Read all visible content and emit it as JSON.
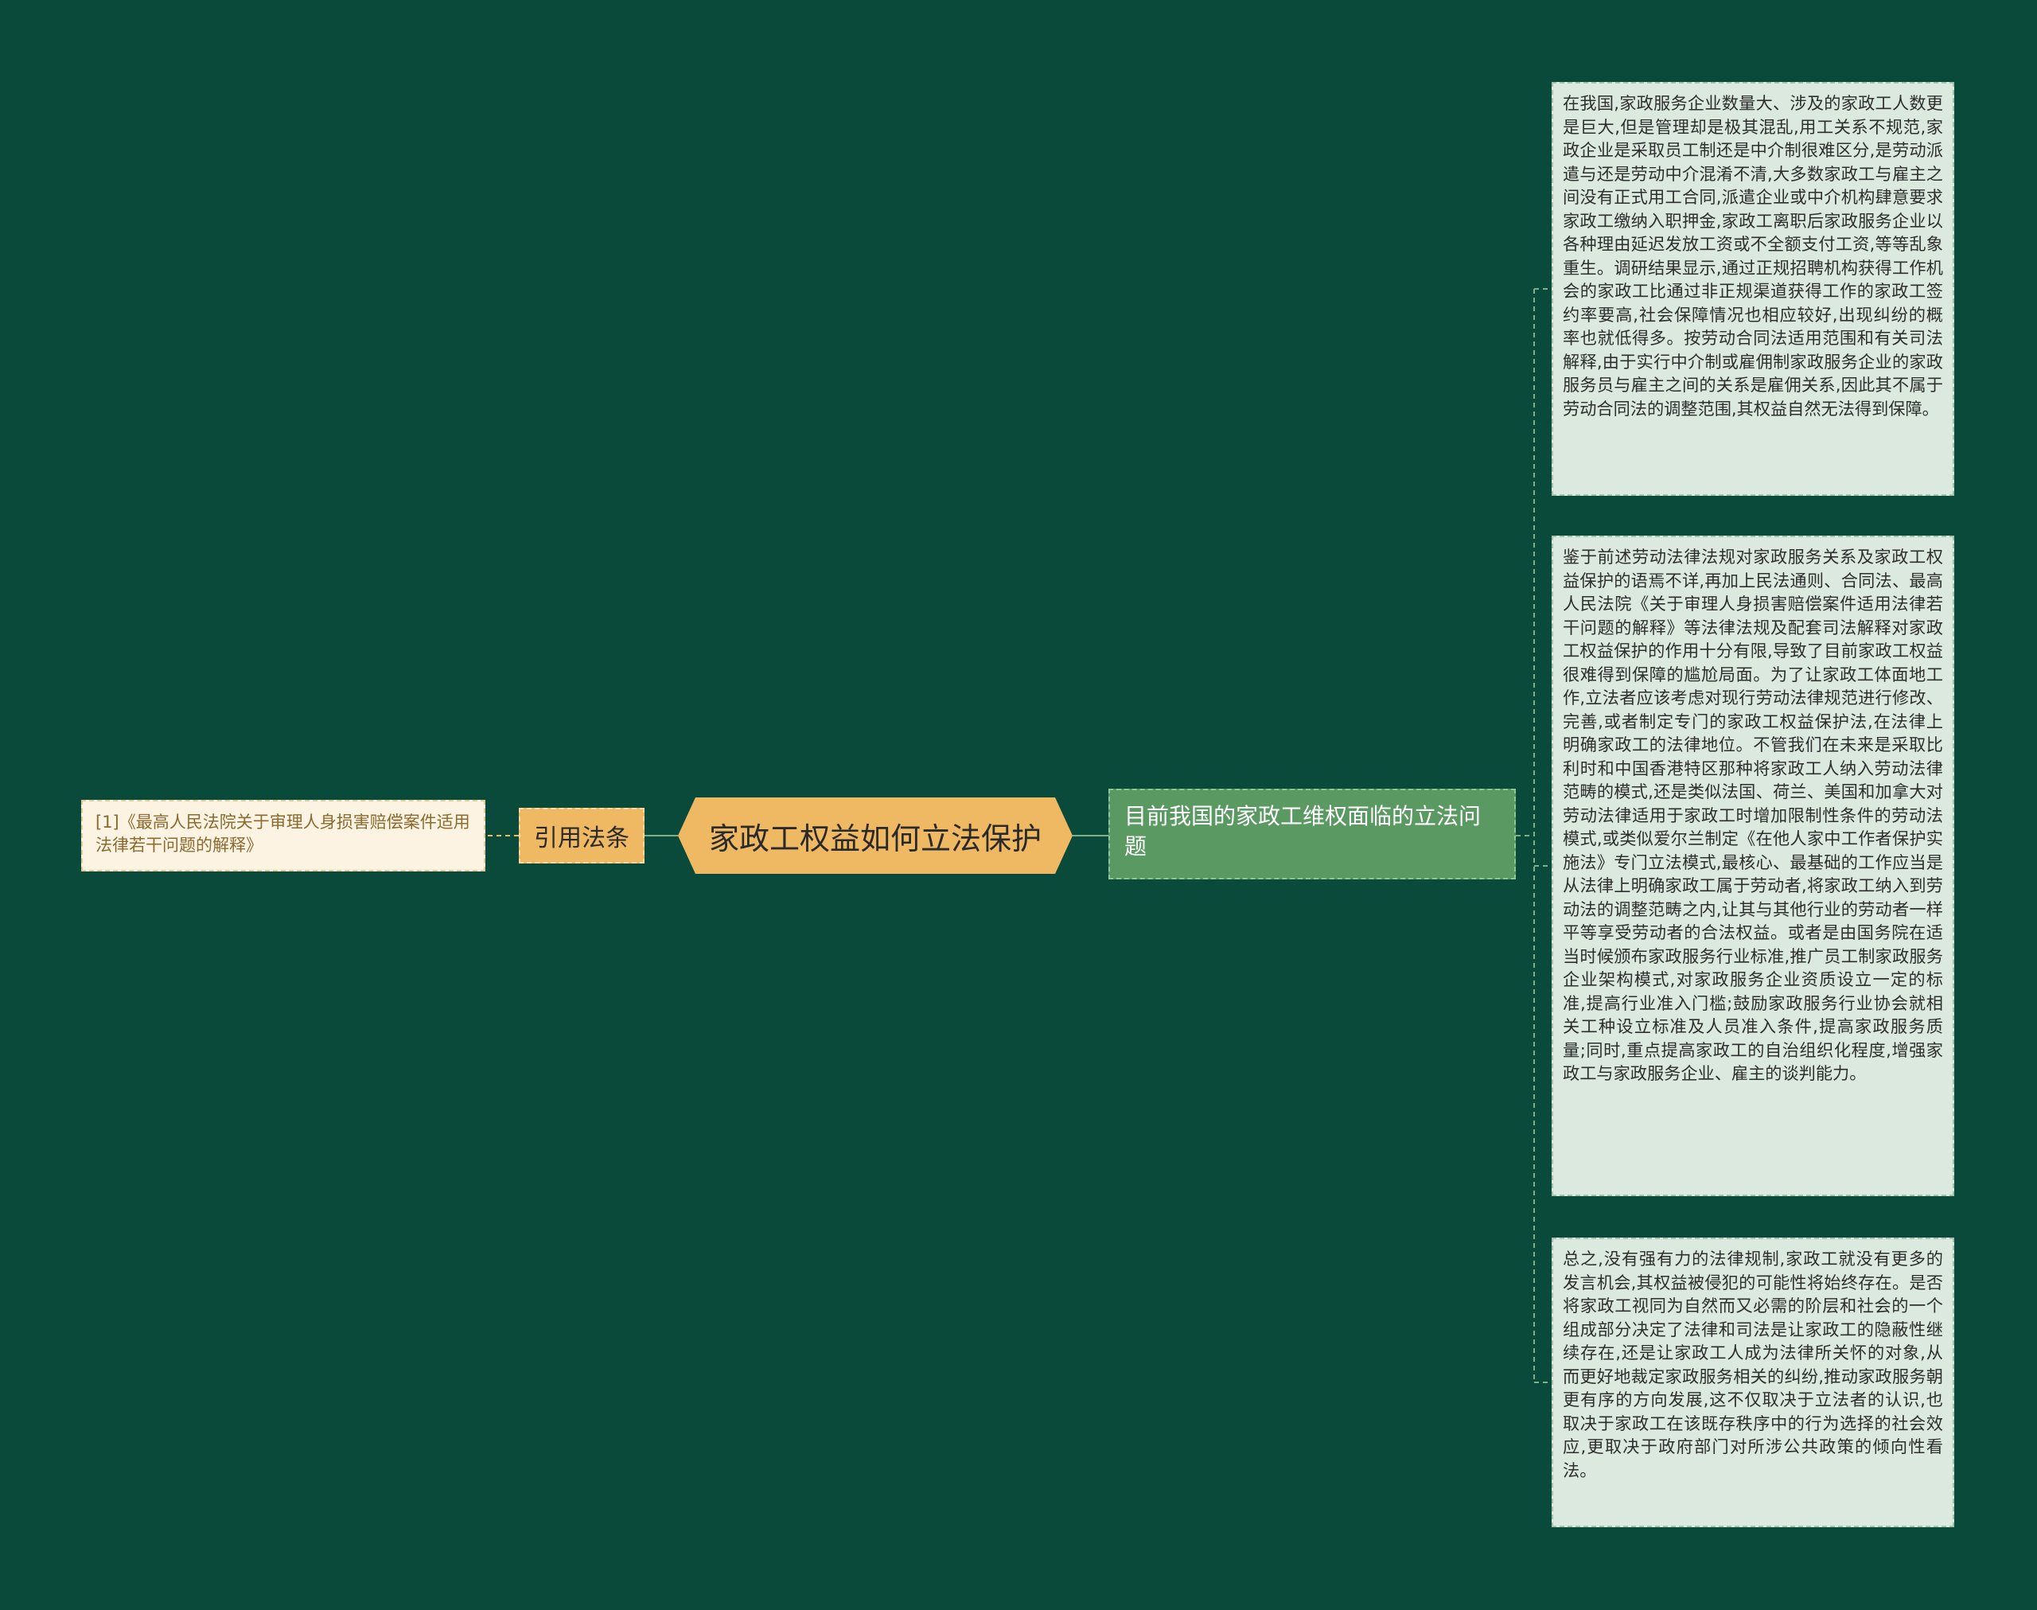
{
  "colors": {
    "background": "#0a4a3a",
    "root": "#efb862",
    "branch": "#5a9a62",
    "leaf": "#dbe9df",
    "cite_leaf": "#fdf3e3",
    "connector": "#7fb08a"
  },
  "mindmap": {
    "root": "家政工权益如何立法保护",
    "citation": {
      "label": "引用法条",
      "leaf": "[1]《最高人民法院关于审理人身损害赔偿案件适用法律若干问题的解释》"
    },
    "branch": {
      "label": "目前我国的家政工维权面临的立法问题",
      "leaves": [
        "在我国,家政服务企业数量大、涉及的家政工人数更是巨大,但是管理却是极其混乱,用工关系不规范,家政企业是采取员工制还是中介制很难区分,是劳动派遣与还是劳动中介混淆不清,大多数家政工与雇主之间没有正式用工合同,派遣企业或中介机构肆意要求家政工缴纳入职押金,家政工离职后家政服务企业以各种理由延迟发放工资或不全额支付工资,等等乱象重生。调研结果显示,通过正规招聘机构获得工作机会的家政工比通过非正规渠道获得工作的家政工签约率要高,社会保障情况也相应较好,出现纠纷的概率也就低得多。按劳动合同法适用范围和有关司法解释,由于实行中介制或雇佣制家政服务企业的家政服务员与雇主之间的关系是雇佣关系,因此其不属于劳动合同法的调整范围,其权益自然无法得到保障。",
        "鉴于前述劳动法律法规对家政服务关系及家政工权益保护的语焉不详,再加上民法通则、合同法、最高人民法院《关于审理人身损害赔偿案件适用法律若干问题的解释》等法律法规及配套司法解释对家政工权益保护的作用十分有限,导致了目前家政工权益很难得到保障的尴尬局面。为了让家政工体面地工作,立法者应该考虑对现行劳动法律规范进行修改、完善,或者制定专门的家政工权益保护法,在法律上明确家政工的法律地位。不管我们在未来是采取比利时和中国香港特区那种将家政工人纳入劳动法律范畴的模式,还是类似法国、荷兰、美国和加拿大对劳动法律适用于家政工时增加限制性条件的劳动法模式,或类似爱尔兰制定《在他人家中工作者保护实施法》专门立法模式,最核心、最基础的工作应当是从法律上明确家政工属于劳动者,将家政工纳入到劳动法的调整范畴之内,让其与其他行业的劳动者一样平等享受劳动者的合法权益。或者是由国务院在适当时候颁布家政服务行业标准,推广员工制家政服务企业架构模式,对家政服务企业资质设立一定的标准,提高行业准入门槛;鼓励家政服务行业协会就相关工种设立标准及人员准入条件,提高家政服务质量;同时,重点提高家政工的自治组织化程度,增强家政工与家政服务企业、雇主的谈判能力。",
        "总之,没有强有力的法律规制,家政工就没有更多的发言机会,其权益被侵犯的可能性将始终存在。是否将家政工视同为自然而又必需的阶层和社会的一个组成部分决定了法律和司法是让家政工的隐蔽性继续存在,还是让家政工人成为法律所关怀的对象,从而更好地裁定家政服务相关的纠纷,推动家政服务朝更有序的方向发展,这不仅取决于立法者的认识,也取决于家政工在该既存秩序中的行为选择的社会效应,更取决于政府部门对所涉公共政策的倾向性看法。"
      ]
    }
  }
}
